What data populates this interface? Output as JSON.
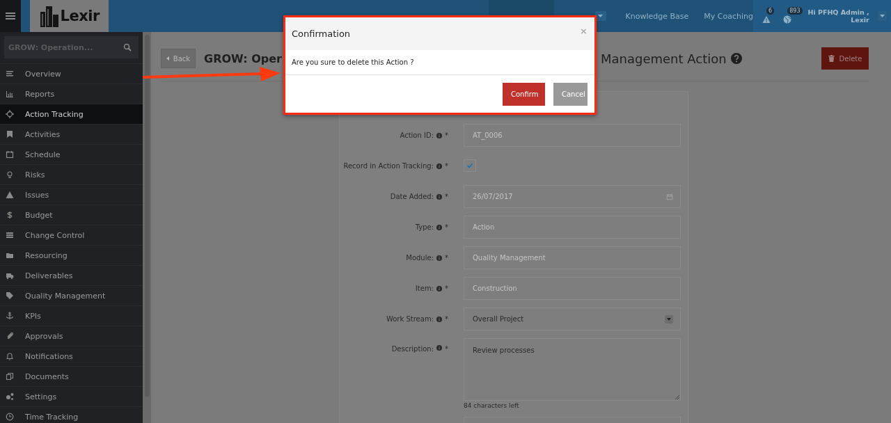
{
  "topbar": {
    "logo_text": "Lexir",
    "nav": [
      {
        "label": "Knowledge Base"
      },
      {
        "label": "My Coaching"
      }
    ],
    "alerts_count": "6",
    "messages_count": "893",
    "user_greeting": "Hi PFHQ Admin ,",
    "user_name": "Lexir"
  },
  "sidebar": {
    "search_value": "GROW: Operation...",
    "items": [
      {
        "label": "Overview",
        "selected": false
      },
      {
        "label": "Reports",
        "selected": false
      },
      {
        "label": "Action Tracking",
        "selected": true
      },
      {
        "label": "Activities",
        "selected": false
      },
      {
        "label": "Schedule",
        "selected": false
      },
      {
        "label": "Risks",
        "selected": false
      },
      {
        "label": "Issues",
        "selected": false
      },
      {
        "label": "Budget",
        "selected": false
      },
      {
        "label": "Change Control",
        "selected": false
      },
      {
        "label": "Resourcing",
        "selected": false
      },
      {
        "label": "Deliverables",
        "selected": false
      },
      {
        "label": "Quality Management",
        "selected": false
      },
      {
        "label": "KPIs",
        "selected": false
      },
      {
        "label": "Approvals",
        "selected": false
      },
      {
        "label": "Notifications",
        "selected": false
      },
      {
        "label": "Documents",
        "selected": false
      },
      {
        "label": "Settings",
        "selected": false
      },
      {
        "label": "Time Tracking",
        "selected": false
      }
    ]
  },
  "page": {
    "back_label": "Back",
    "title_left": "GROW: Oper",
    "title_right": "Management Action",
    "delete_label": "Delete"
  },
  "form": {
    "fields": [
      {
        "kind": "text",
        "label": "Action ID:",
        "required_mark": "*",
        "value": "AT_0006",
        "disabled": true
      },
      {
        "kind": "checkbox",
        "label": "Record in Action Tracking:",
        "required_mark": "*",
        "checked": true
      },
      {
        "kind": "date",
        "label": "Date Added:",
        "required_mark": "*",
        "value": "26/07/2017",
        "disabled": true
      },
      {
        "kind": "text",
        "label": "Type:",
        "required_mark": "*",
        "value": "Action",
        "disabled": true
      },
      {
        "kind": "text",
        "label": "Module:",
        "required_mark": "*",
        "value": "Quality Management",
        "disabled": true
      },
      {
        "kind": "text",
        "label": "Item:",
        "required_mark": "*",
        "value": "Construction",
        "disabled": true
      },
      {
        "kind": "select",
        "label": "Work Stream:",
        "required_mark": "*",
        "value": "Overall Project",
        "disabled": false
      },
      {
        "kind": "textarea",
        "label": "Description:",
        "required_mark": "*",
        "value": "Review processes",
        "disabled": false,
        "counter": "84 characters left"
      }
    ]
  },
  "modal": {
    "title": "Confirmation",
    "close": "×",
    "message": "Are you sure to delete this Action ?",
    "buttons": [
      {
        "label": "Confirm",
        "kind": "primary"
      },
      {
        "label": "Cancel",
        "kind": "secondary"
      }
    ]
  }
}
